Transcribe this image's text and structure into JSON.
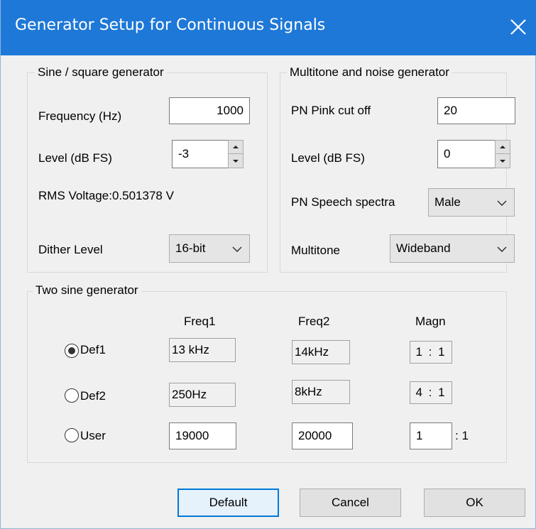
{
  "window": {
    "title": "Generator Setup for Continuous Signals"
  },
  "sine": {
    "legend": "Sine / square generator",
    "frequency_label": "Frequency (Hz)",
    "frequency_value": "1000",
    "level_label": "Level (dB FS)",
    "level_value": "-3",
    "rms_text": "RMS Voltage:0.501378 V",
    "dither_label": "Dither Level",
    "dither_value": "16-bit"
  },
  "multitone": {
    "legend": "Multitone and noise generator",
    "pink_label": "PN Pink cut off",
    "pink_value": "20",
    "level_label": "Level (dB FS)",
    "level_value": "0",
    "speech_label": "PN Speech spectra",
    "speech_value": "Male",
    "multitone_label": "Multitone",
    "multitone_value": "Wideband"
  },
  "two_sine": {
    "legend": "Two sine generator",
    "headers": {
      "freq1": "Freq1",
      "freq2": "Freq2",
      "magn": "Magn"
    },
    "rows": [
      {
        "label": "Def1",
        "freq1": "13 kHz",
        "freq2": "14kHz",
        "magn": "1 : 1",
        "selected": true
      },
      {
        "label": "Def2",
        "freq1": "250Hz",
        "freq2": "8kHz",
        "magn": "4 : 1",
        "selected": false
      },
      {
        "label": "User",
        "freq1": "19000",
        "freq2": "20000",
        "magn": "1",
        "magn_suffix": ": 1",
        "selected": false
      }
    ]
  },
  "buttons": {
    "default": "Default",
    "cancel": "Cancel",
    "ok": "OK"
  },
  "icons": {
    "close": "close-icon",
    "spin_up": "chevron-up-icon",
    "spin_down": "chevron-down-icon",
    "dropdown": "chevron-down-icon",
    "radio": "radio-icon"
  },
  "colors": {
    "titlebar": "#1e78d7",
    "default_button_border": "#0078d7"
  }
}
